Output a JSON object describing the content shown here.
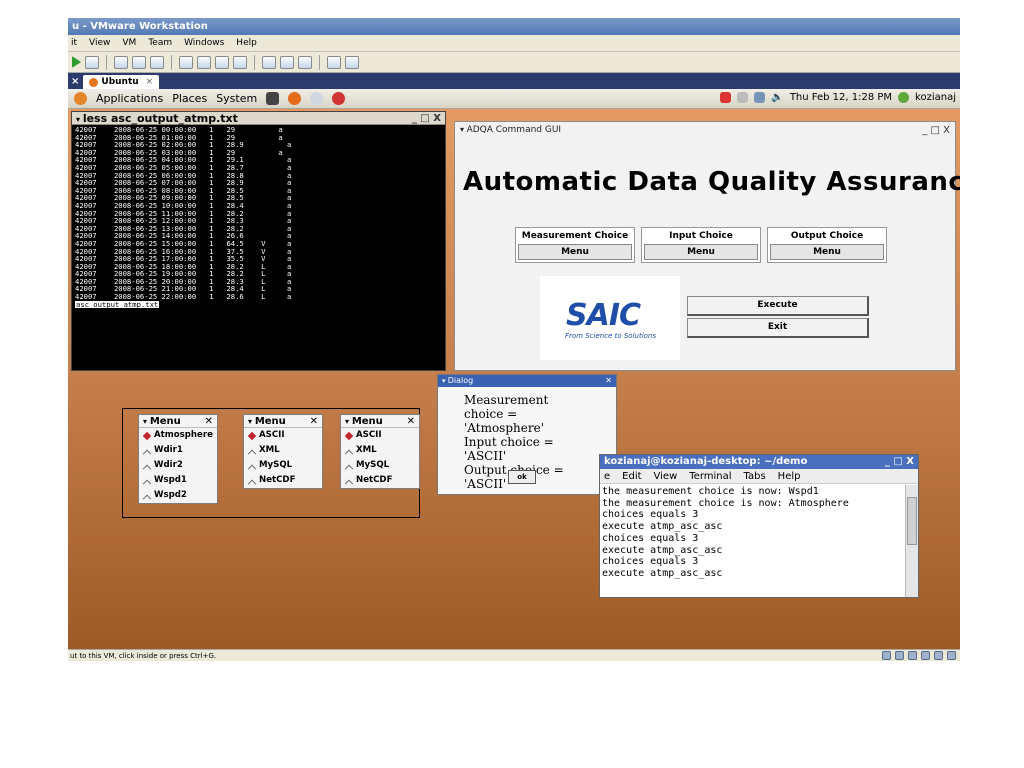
{
  "vmware": {
    "title": "u - VMware Workstation",
    "menu": [
      "it",
      "View",
      "VM",
      "Team",
      "Windows",
      "Help"
    ],
    "tab_label": "Ubuntu",
    "tab_close": "×",
    "status": "ut to this VM, click inside or press Ctrl+G."
  },
  "panel": {
    "items": [
      "Applications",
      "Places",
      "System"
    ],
    "clock": "Thu Feb 12,  1:28 PM",
    "user": "kozianaj"
  },
  "less_terminal": {
    "title": "less asc_output_atmp.txt",
    "controls": "_ □ X",
    "lines": [
      "42007    2008-06-25 00:00:00   1   29          a",
      "42007    2008-06-25 01:00:00   1   29          a",
      "42007    2008-06-25 02:00:00   1   28.9          a",
      "42007    2008-06-25 03:00:00   1   29          a",
      "42007    2008-06-25 04:00:00   1   29.1          a",
      "42007    2008-06-25 05:00:00   1   28.7          a",
      "42007    2008-06-25 06:00:00   1   28.8          a",
      "42007    2008-06-25 07:00:00   1   28.9          a",
      "42007    2008-06-25 08:00:00   1   28.5          a",
      "42007    2008-06-25 09:00:00   1   28.5          a",
      "42007    2008-06-25 10:00:00   1   28.4          a",
      "42007    2008-06-25 11:00:00   1   28.2          a",
      "42007    2008-06-25 12:00:00   1   28.3          a",
      "42007    2008-06-25 13:00:00   1   28.2          a",
      "42007    2008-06-25 14:00:00   1   26.6          a",
      "42007    2008-06-25 15:00:00   1   64.5    V     a",
      "42007    2008-06-25 16:00:00   1   37.5    V     a",
      "42007    2008-06-25 17:00:00   1   35.5    V     a",
      "42007    2008-06-25 18:00:00   1   28.2    L     a",
      "42007    2008-06-25 19:00:00   1   28.2    L     a",
      "42007    2008-06-25 20:00:00   1   28.3    L     a",
      "42007    2008-06-25 21:00:00   1   28.4    L     a",
      "42007    2008-06-25 22:00:00   1   28.6    L     a"
    ],
    "prompt": "asc_output_atmp.txt"
  },
  "adqa": {
    "title": "ADQA Command GUI",
    "controls": "_ □ X",
    "heading": "Automatic Data Quality Assurance",
    "columns": [
      {
        "label": "Measurement Choice",
        "button": "Menu"
      },
      {
        "label": "Input Choice",
        "button": "Menu"
      },
      {
        "label": "Output Choice",
        "button": "Menu"
      }
    ],
    "logo": "SAIC",
    "logo_tagline": "From Science to Solutions",
    "execute": "Execute",
    "exit": "Exit"
  },
  "menus": [
    {
      "title": "Menu",
      "items": [
        "Atmosphere",
        "Wdir1",
        "Wdir2",
        "Wspd1",
        "Wspd2"
      ],
      "selected": 0
    },
    {
      "title": "Menu",
      "items": [
        "ASCII",
        "XML",
        "MySQL",
        "NetCDF"
      ],
      "selected": 0
    },
    {
      "title": "Menu",
      "items": [
        "ASCII",
        "XML",
        "MySQL",
        "NetCDF"
      ],
      "selected": 0
    }
  ],
  "dialog": {
    "title": "Dialog",
    "lines": [
      "Measurement choice =",
      "'Atmosphere'",
      "Input choice = 'ASCII'",
      "Output choice = 'ASCII'"
    ],
    "ok": "ok"
  },
  "gnome_terminal": {
    "title": "kozianaj@kozianaj-desktop: ~/demo",
    "controls": "_ □ X",
    "menu": [
      "e",
      "Edit",
      "View",
      "Terminal",
      "Tabs",
      "Help"
    ],
    "lines": [
      "the measurement choice is now: Wspd1",
      "the measurement choice is now: Atmosphere",
      "choices equals 3",
      "execute atmp_asc_asc",
      "choices equals 3",
      "execute atmp_asc_asc",
      "choices equals 3",
      "execute atmp_asc_asc"
    ]
  }
}
